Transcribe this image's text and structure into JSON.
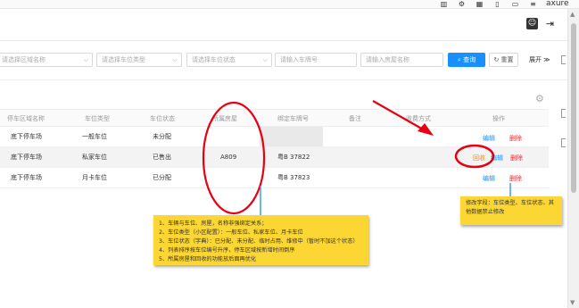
{
  "browser": {
    "brand": "axure",
    "icons": [
      "book-icon",
      "gear-icon",
      "grid-icon",
      "bookmark-icon",
      "window-icon",
      "menu-icon"
    ]
  },
  "header": {
    "icons": [
      "user-icon",
      "logout-icon"
    ]
  },
  "filters": {
    "region_placeholder": "请选择区域名称",
    "type_placeholder": "请选择车位类型",
    "status_placeholder": "请选择车位状态",
    "plate_placeholder": "请输入车牌号",
    "room_placeholder": "请输入房屋名称",
    "search_label": "查询",
    "reset_label": "重置",
    "expand_label": "展开"
  },
  "table": {
    "columns": [
      "停车区域名称",
      "车位类型",
      "车位状态",
      "所属房屋",
      "绑定车牌号",
      "备注",
      "收费方式",
      "操作"
    ],
    "rows": [
      {
        "area": "底下停车场",
        "type": "一般车位",
        "status": "未分配",
        "house": "",
        "plate": ""
      },
      {
        "area": "底下停车场",
        "type": "私家车位",
        "status": "已售出",
        "house": "A809",
        "plate": "粤B 37822"
      },
      {
        "area": "底下停车场",
        "type": "月卡车位",
        "status": "已分配",
        "house": "",
        "plate": "粤B 37823"
      }
    ],
    "ops": {
      "edit": "编辑",
      "delete": "删除",
      "recover": "回收"
    }
  },
  "notes": {
    "main": [
      "1、车辆与车位、房屋，名称非强绑定关系；",
      "2、车位类型（小区配置）：一般车位、私家车位、月卡车位",
      "3、车位状态（字典）：已分配、未分配、临时占用、维修中（暂时不加这个状态）",
      "4、列表排序按车位编号升序，停车区域按新增时间倒序",
      "5、所属房屋和回收的功能放后面再优化"
    ],
    "side": "修改字段：车位类型、车位状态、其他数据禁止修改"
  },
  "colors": {
    "primary": "#1890ff",
    "danger": "#f5222d",
    "recover": "#fa8c16",
    "note": "#fcd734",
    "annotation_red": "#e60012"
  }
}
